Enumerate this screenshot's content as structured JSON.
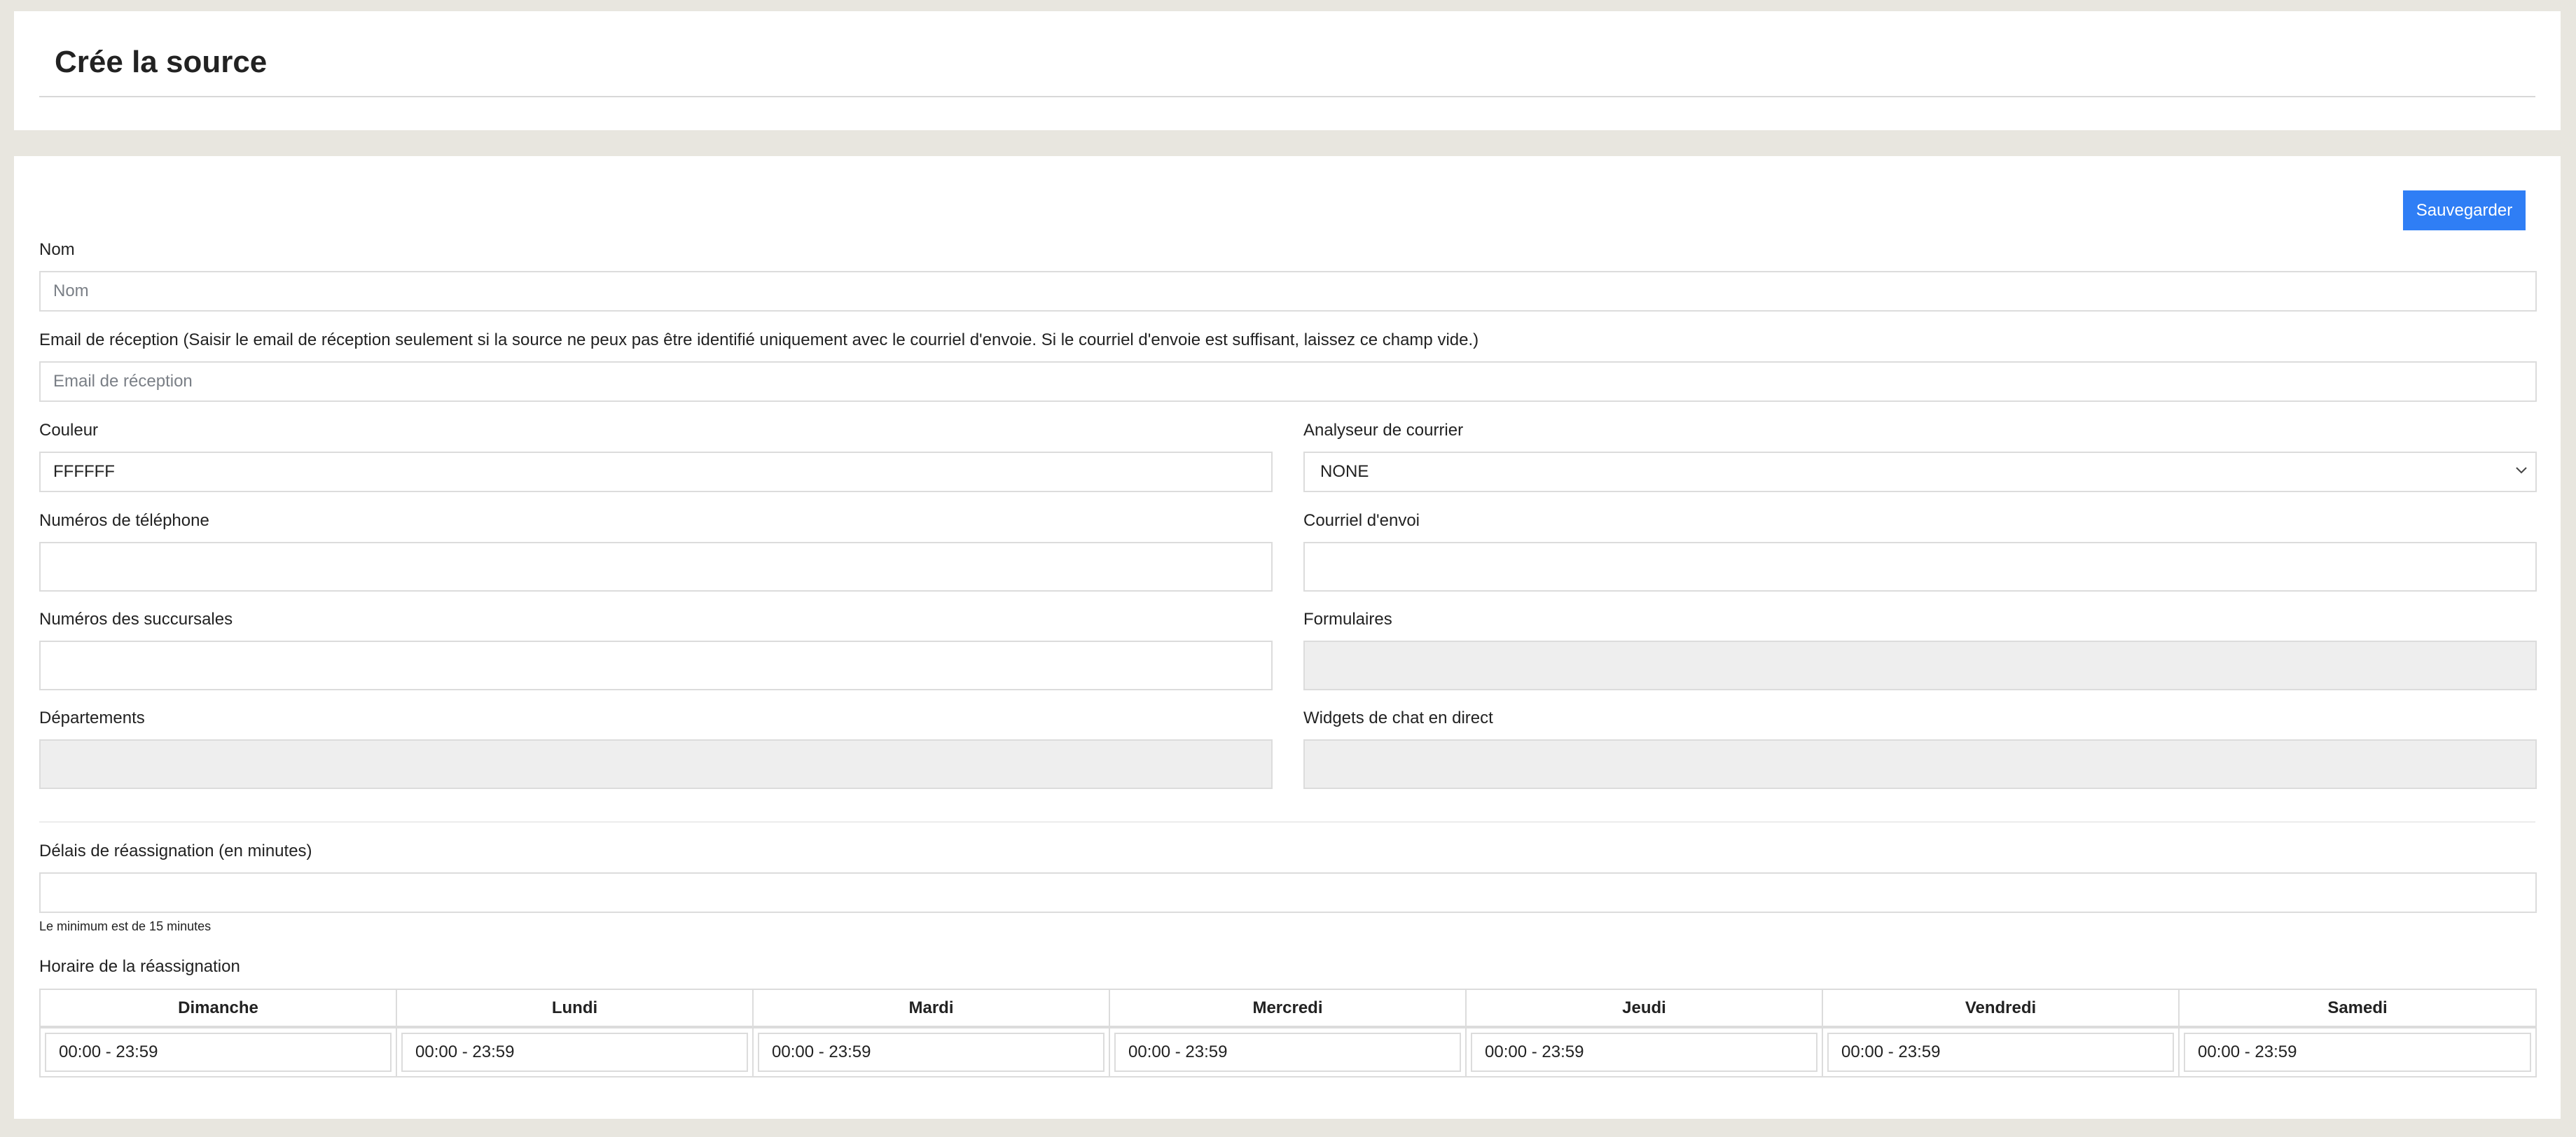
{
  "header": {
    "title": "Crée la source"
  },
  "toolbar": {
    "save_label": "Sauvegarder"
  },
  "form": {
    "name": {
      "label": "Nom",
      "placeholder": "Nom",
      "value": ""
    },
    "email": {
      "label": "Email de réception (Saisir le email de réception seulement si la source ne peux pas être identifié uniquement avec le courriel d'envoie. Si le courriel d'envoie est suffisant, laissez ce champ vide.)",
      "placeholder": "Email de réception",
      "value": ""
    },
    "color": {
      "label": "Couleur",
      "value": "FFFFFF"
    },
    "mail_parser": {
      "label": "Analyseur de courrier",
      "selected": "NONE",
      "icon": "chevron-down-icon"
    },
    "phones": {
      "label": "Numéros de téléphone",
      "value": ""
    },
    "sender_email": {
      "label": "Courriel d'envoi",
      "value": ""
    },
    "branches": {
      "label": "Numéros des succursales",
      "value": ""
    },
    "forms": {
      "label": "Formulaires",
      "value": ""
    },
    "departments": {
      "label": "Départements",
      "value": ""
    },
    "chat_widgets": {
      "label": "Widgets de chat en direct",
      "value": ""
    },
    "reassign_delay": {
      "label": "Délais de réassignation (en minutes)",
      "value": "",
      "help": "Le minimum est de 15 minutes"
    }
  },
  "schedule": {
    "label": "Horaire de la réassignation",
    "days": [
      {
        "name": "Dimanche",
        "hours": "00:00 - 23:59"
      },
      {
        "name": "Lundi",
        "hours": "00:00 - 23:59"
      },
      {
        "name": "Mardi",
        "hours": "00:00 - 23:59"
      },
      {
        "name": "Mercredi",
        "hours": "00:00 - 23:59"
      },
      {
        "name": "Jeudi",
        "hours": "00:00 - 23:59"
      },
      {
        "name": "Vendredi",
        "hours": "00:00 - 23:59"
      },
      {
        "name": "Samedi",
        "hours": "00:00 - 23:59"
      }
    ]
  },
  "colors": {
    "accent": "#2f7ef5",
    "page_background": "#e8e6df",
    "disabled_field": "#eeeeee"
  }
}
